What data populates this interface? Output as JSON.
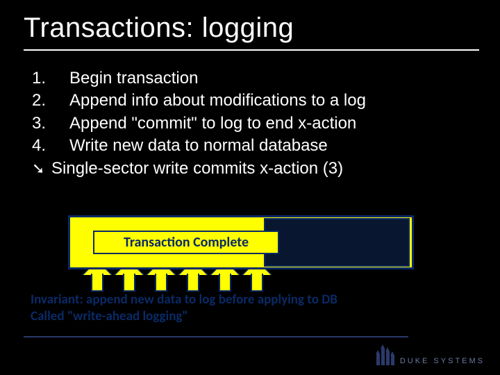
{
  "title": "Transactions: logging",
  "list": {
    "items": [
      {
        "num": "1.",
        "text": "Begin transaction"
      },
      {
        "num": "2.",
        "text": "Append info about modifications to a log"
      },
      {
        "num": "3.",
        "text": "Append \"commit\" to log to end x-action"
      },
      {
        "num": "4.",
        "text": "Write new data to normal database"
      }
    ],
    "arrow_glyph": "➘",
    "arrow_text": "Single-sector write commits x-action (3)"
  },
  "diagram": {
    "label": "Transaction Complete",
    "arrow_count": 6
  },
  "invariant": {
    "line1": "Invariant: append new data to log before applying to DB",
    "line2": "Called \"write-ahead logging\""
  },
  "footer": {
    "logo_text": "Duke Systems"
  }
}
